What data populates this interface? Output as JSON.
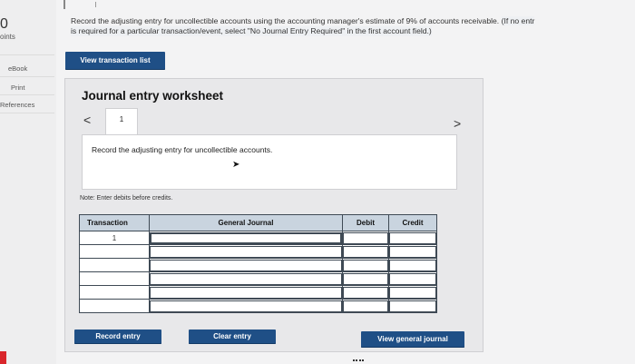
{
  "sidebar": {
    "score": "0",
    "points_label": "oints",
    "links": [
      "eBook",
      "Print",
      "References"
    ]
  },
  "question": {
    "line1": "Record the adjusting entry for uncollectible accounts using the accounting manager's estimate of 9% of accounts receivable.",
    "line1_note": "(If no entr",
    "line2": "is required for a particular transaction/event, select \"No Journal Entry Required\" in the first account field.)"
  },
  "buttons": {
    "view_transaction_list": "View transaction list",
    "record_entry": "Record entry",
    "clear_entry": "Clear entry",
    "view_general_journal": "View general journal"
  },
  "worksheet": {
    "title": "Journal entry worksheet",
    "prev": "<",
    "next": ">",
    "page": "1",
    "instruction": "Record the adjusting entry for uncollectible accounts.",
    "note": "Note: Enter debits before credits."
  },
  "journal": {
    "headers": {
      "transaction": "Transaction",
      "general_journal": "General Journal",
      "debit": "Debit",
      "credit": "Credit"
    },
    "rows": [
      {
        "transaction": "1",
        "account": "",
        "debit": "",
        "credit": ""
      },
      {
        "transaction": "",
        "account": "",
        "debit": "",
        "credit": ""
      },
      {
        "transaction": "",
        "account": "",
        "debit": "",
        "credit": ""
      },
      {
        "transaction": "",
        "account": "",
        "debit": "",
        "credit": ""
      },
      {
        "transaction": "",
        "account": "",
        "debit": "",
        "credit": ""
      },
      {
        "transaction": "",
        "account": "",
        "debit": "",
        "credit": ""
      }
    ]
  },
  "colors": {
    "button": "#1f4f86",
    "table_header": "#c9d4df",
    "accent_red": "#d9262b"
  }
}
